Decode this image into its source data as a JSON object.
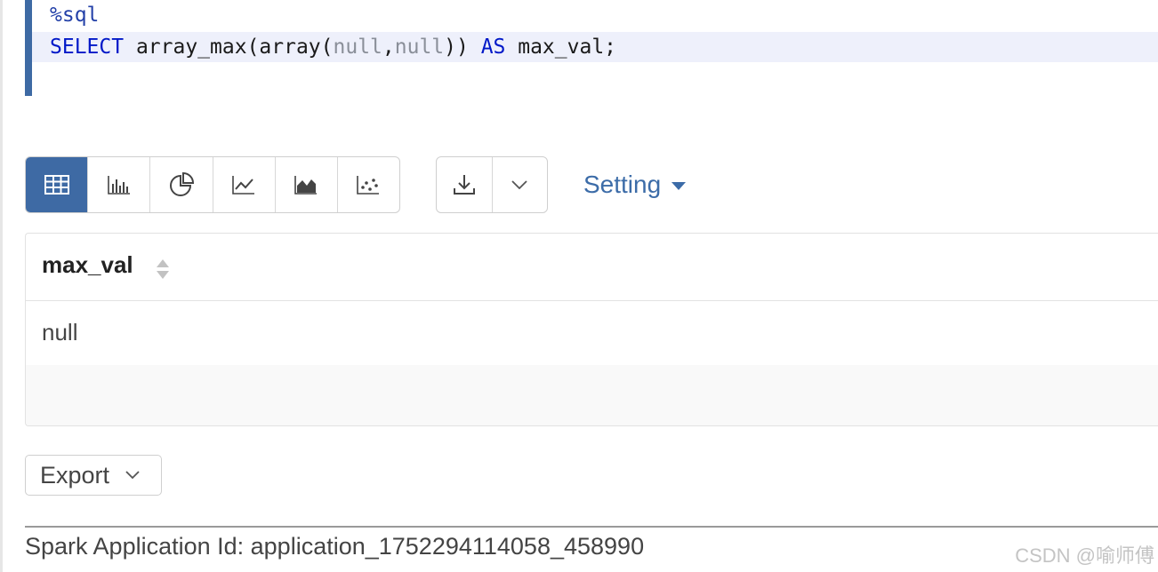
{
  "editor": {
    "line1": "%sql",
    "line2": {
      "t1": "SELECT",
      "t2": " array_max(array(",
      "t3": "null",
      "t4": ",",
      "t5": "null",
      "t6": ")) ",
      "t7": "AS",
      "t8": " max_val;"
    },
    "colors": {
      "keyword": "#0018c8",
      "null": "#8a8f99",
      "accent_bar": "#3e6aa4"
    }
  },
  "toolbar": {
    "chart_buttons": [
      {
        "icon": "table-icon",
        "active": true
      },
      {
        "icon": "bar-chart-icon",
        "active": false
      },
      {
        "icon": "pie-chart-icon",
        "active": false
      },
      {
        "icon": "line-chart-icon",
        "active": false
      },
      {
        "icon": "area-chart-icon",
        "active": false
      },
      {
        "icon": "scatter-chart-icon",
        "active": false
      }
    ],
    "download_icon": "download-icon",
    "dropdown_icon": "chevron-down-icon",
    "setting_label": "Setting"
  },
  "result": {
    "columns": [
      "max_val"
    ],
    "rows": [
      [
        "null"
      ]
    ]
  },
  "export_label": "Export",
  "footer": {
    "app_id": "Spark Application Id: application_1752294114058_458990",
    "watermark": "CSDN @喻师傅"
  }
}
